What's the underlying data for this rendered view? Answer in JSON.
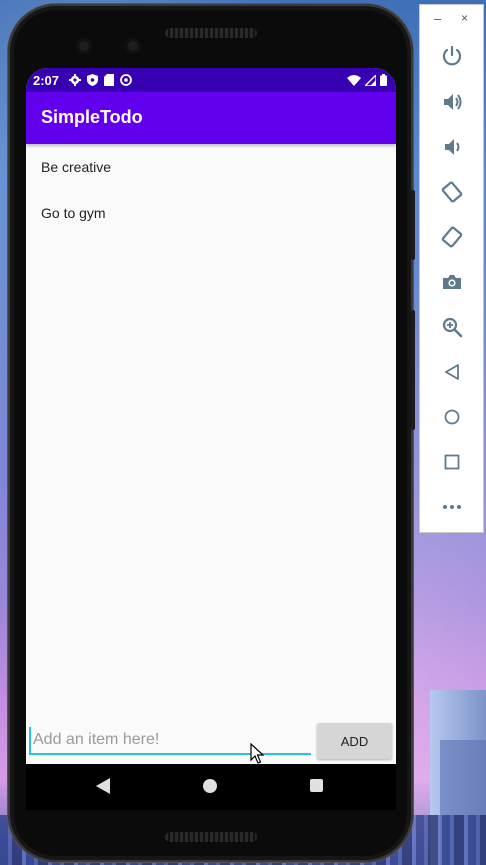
{
  "status_bar": {
    "time": "2:07"
  },
  "app": {
    "title": "SimpleTodo"
  },
  "todo_list": {
    "items": [
      "Be creative",
      "Go to gym"
    ]
  },
  "new_item": {
    "placeholder": "Add an item here!",
    "value": "",
    "add_label": "ADD"
  },
  "colors": {
    "status_bar": "#3700b3",
    "app_bar": "#6200ee",
    "input_accent": "#26c6da",
    "panel_icon": "#5f7a8c"
  },
  "emulator_panel": {
    "window_buttons": {
      "minimize": "–",
      "close": "×"
    },
    "icons": [
      "power-icon",
      "volume-up-icon",
      "volume-down-icon",
      "rotate-left-icon",
      "rotate-right-icon",
      "camera-icon",
      "zoom-icon",
      "back-icon",
      "home-icon",
      "overview-icon",
      "more-icon"
    ]
  },
  "nav_icons": [
    "back-icon",
    "home-icon",
    "recents-icon"
  ]
}
